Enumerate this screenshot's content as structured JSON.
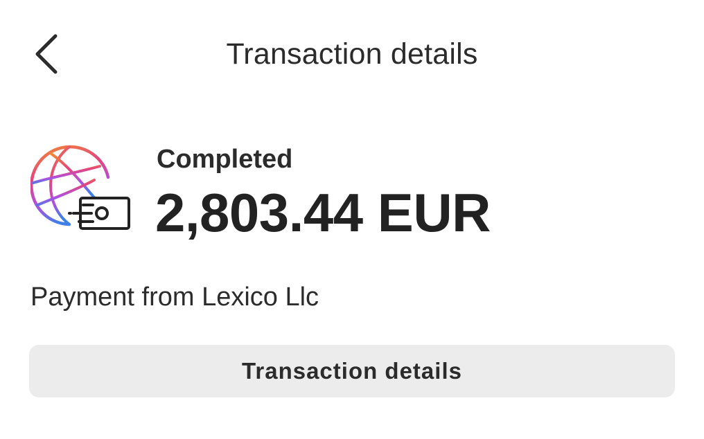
{
  "header": {
    "title": "Transaction details",
    "back_icon": "chevron-left-icon"
  },
  "summary": {
    "icon": "globe-money-transfer-icon",
    "status": "Completed",
    "amount": "2,803.44 EUR",
    "icon_gradient": [
      "#f28b30",
      "#e6457a",
      "#b04fe0",
      "#3f7fe8"
    ],
    "icon_stroke": "#222222"
  },
  "description": "Payment from Lexico Llc",
  "actions": {
    "details_button_label": "Transaction details"
  },
  "colors": {
    "background": "#ffffff",
    "text": "#262626",
    "button_bg": "#ececec"
  }
}
